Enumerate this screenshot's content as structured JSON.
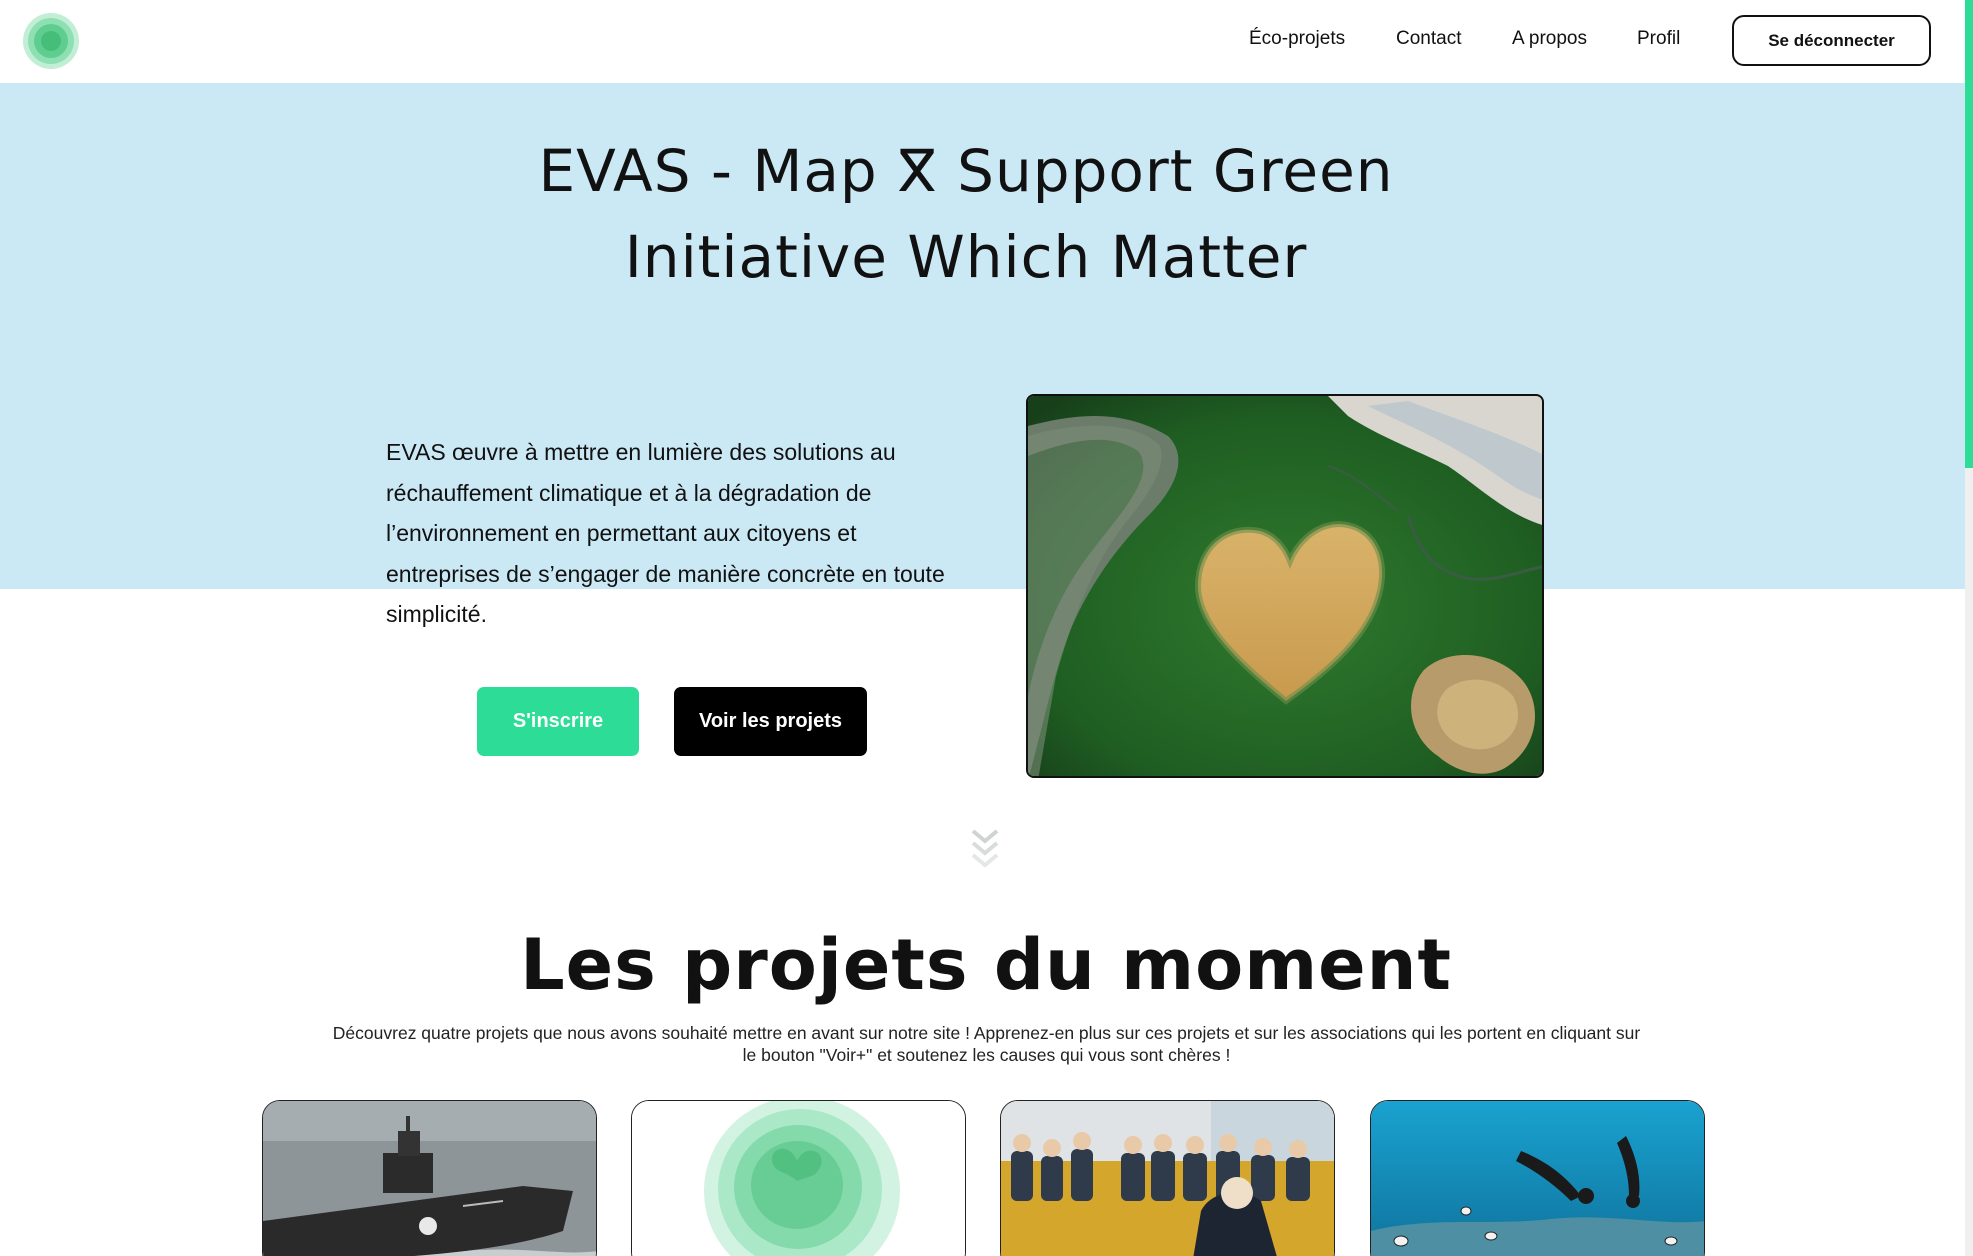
{
  "header": {
    "logo_name": "evas-logo",
    "nav": [
      {
        "label": "Éco-projets"
      },
      {
        "label": "Contact"
      },
      {
        "label": "A propos"
      },
      {
        "label": "Profil"
      }
    ],
    "logout_label": "Se déconnecter"
  },
  "hero": {
    "title_line1": "EVAS - Map ⴳ Support Green",
    "title_line2": "Initiative Which Matter",
    "description": "EVAS œuvre à mettre en lumière des solutions au réchauffement climatique et à la dégradation de l’environnement en permettant aux citoyens et entreprises de s’engager de manière concrète en toute simplicité.",
    "signup_label": "S'inscrire",
    "projects_label": "Voir les projets",
    "image_name": "heart-of-voh-aerial-photo",
    "scroll_icon": "double-chevron-down-icon"
  },
  "projects": {
    "title": "Les projets du moment",
    "description": "Découvrez quatre projets que nous avons souhaité mettre en avant sur notre site ! Apprenez-en plus sur ces projets et sur les associations qui les portent en cliquant sur le bouton \"Voir+\" et soutenez les causes qui vous sont chères !",
    "cards": [
      {
        "image": "sea-shepherd-ship-photo"
      },
      {
        "image": "evas-logo-placeholder"
      },
      {
        "image": "children-classroom-photo"
      },
      {
        "image": "coral-reef-divers-photo"
      }
    ]
  },
  "colors": {
    "accent": "#2ddc96",
    "hero_bg": "#cbe8f5",
    "dark": "#000000"
  }
}
